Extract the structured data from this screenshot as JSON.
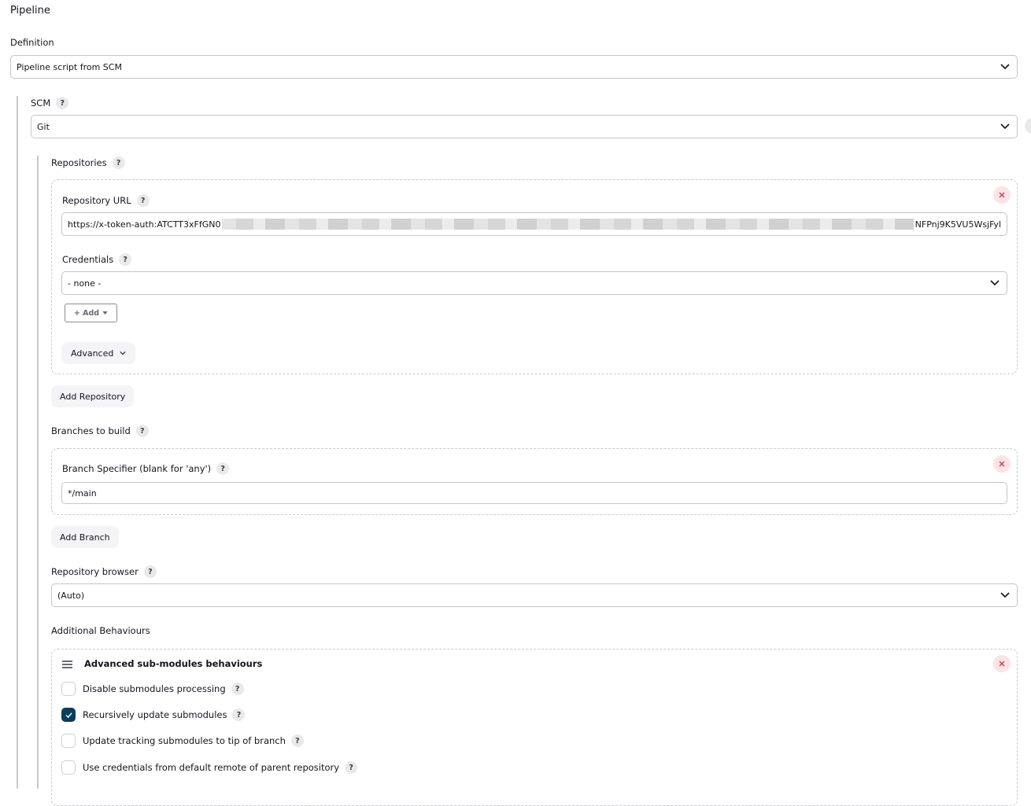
{
  "section": {
    "title": "Pipeline"
  },
  "definition": {
    "label": "Definition",
    "selected": "Pipeline script from SCM"
  },
  "scm": {
    "label": "SCM",
    "selected": "Git"
  },
  "repositories": {
    "label": "Repositories",
    "url_label": "Repository URL",
    "url_value_start": "https://x-token-auth:ATCTT3xFfGN0",
    "url_value_end": "NFPnj9K5VU5WsjFyl",
    "credentials_label": "Credentials",
    "credentials_selected": "- none -",
    "add_button": "+ Add",
    "advanced_button": "Advanced",
    "add_repository_button": "Add Repository"
  },
  "branches": {
    "label": "Branches to build",
    "specifier_label": "Branch Specifier (blank for 'any')",
    "specifier_value": "*/main",
    "add_branch_button": "Add Branch"
  },
  "repository_browser": {
    "label": "Repository browser",
    "selected": "(Auto)"
  },
  "additional_behaviours": {
    "label": "Additional Behaviours",
    "submodules": {
      "title": "Advanced sub-modules behaviours",
      "options": [
        {
          "label": "Disable submodules processing",
          "checked": false
        },
        {
          "label": "Recursively update submodules",
          "checked": true
        },
        {
          "label": "Update tracking submodules to tip of branch",
          "checked": false
        },
        {
          "label": "Use credentials from default remote of parent repository",
          "checked": false
        }
      ]
    }
  },
  "icons": {
    "help": "?",
    "chevron": "chevron-down-icon",
    "close": "close-icon",
    "drag": "drag-handle-icon",
    "check": "check-icon"
  },
  "colors": {
    "checkbox_checked": "#0b3c5d",
    "close_bg": "#fbe3e6",
    "close_fg": "#d33a55"
  }
}
